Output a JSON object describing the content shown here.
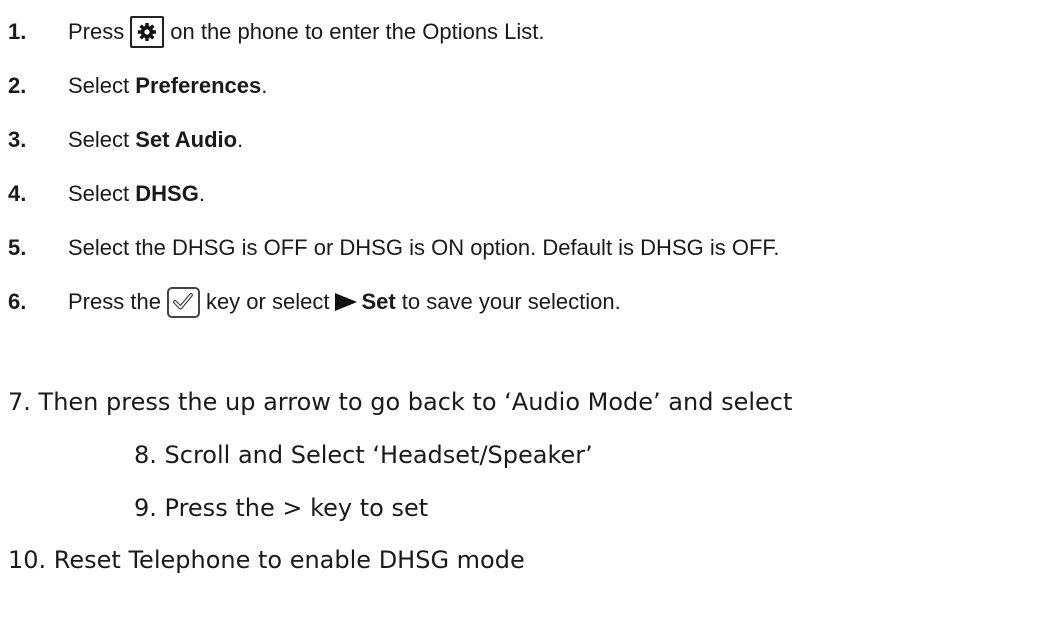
{
  "steps": [
    {
      "num": "1.",
      "pre": "Press",
      "post": "on the phone to enter the Options List.",
      "icon": "gear-icon"
    },
    {
      "num": "2.",
      "pre": "Select ",
      "bold": "Preferences",
      "post": "."
    },
    {
      "num": "3.",
      "pre": "Select ",
      "bold": "Set Audio",
      "post": "."
    },
    {
      "num": "4.",
      "pre": "Select ",
      "bold": "DHSG",
      "post": "."
    },
    {
      "num": "5.",
      "text": "Select the DHSG is OFF or DHSG is ON option. Default is DHSG is OFF."
    },
    {
      "num": "6.",
      "pre": "Press the",
      "mid": "key or select",
      "bold": "Set",
      "post": " to save your selection.",
      "icon": "checkmark-icon",
      "arrow": "play-arrow-icon"
    }
  ],
  "extra_steps": [
    "7. Then press the up arrow to go back to ‘Audio Mode’ and select",
    "8. Scroll and Select ‘Headset/Speaker’",
    "9. Press the > key to set",
    "10. Reset Telephone to enable DHSG mode"
  ]
}
